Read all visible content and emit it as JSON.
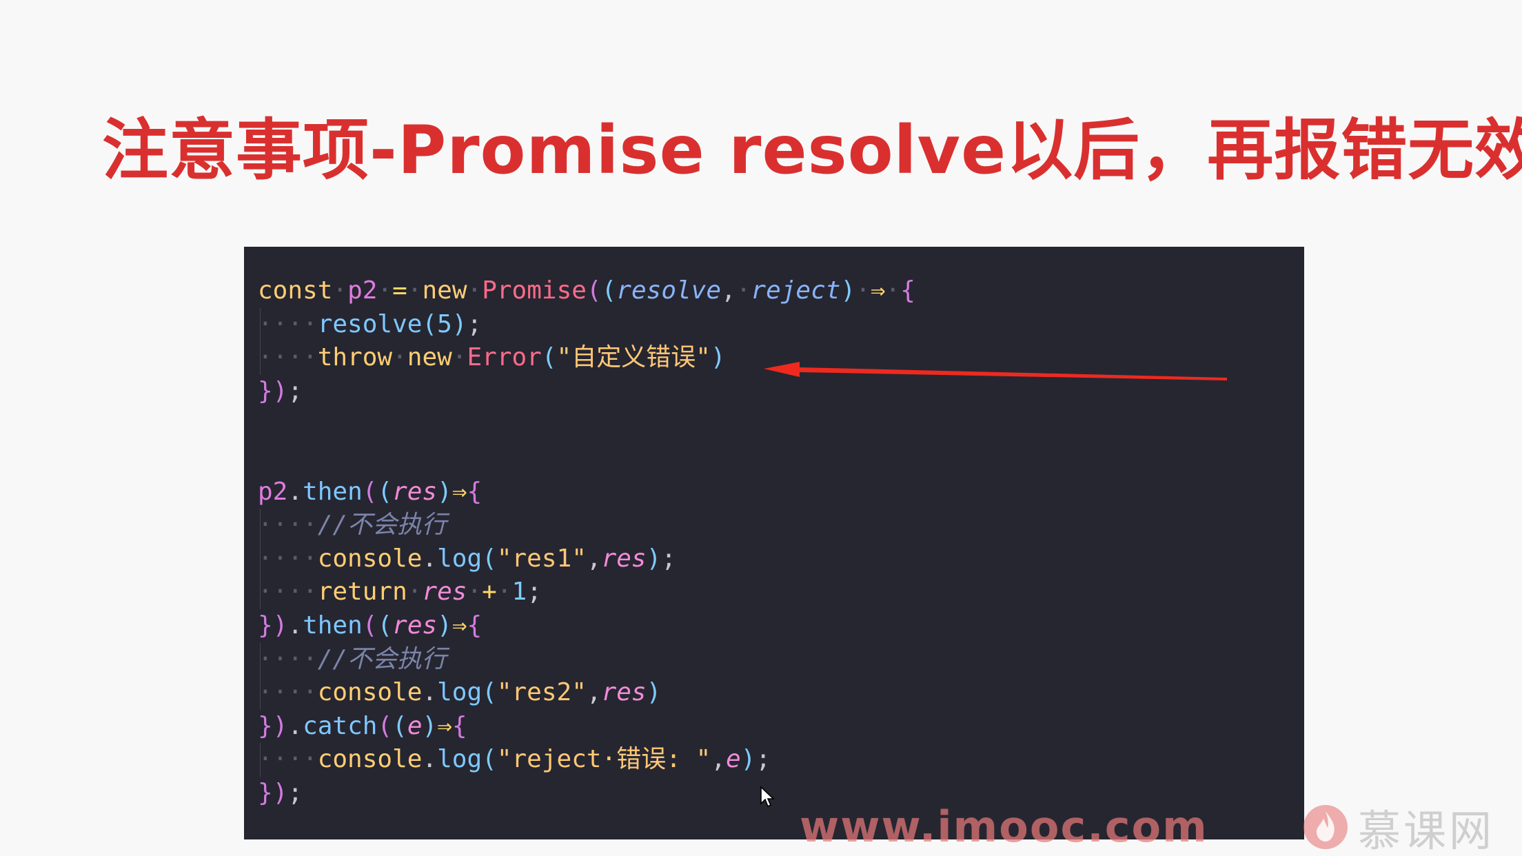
{
  "slide": {
    "title": "注意事项-Promise resolve以后，再报错无效"
  },
  "code": {
    "lines": [
      {
        "tokens": [
          [
            "kw",
            "const"
          ],
          [
            "dot",
            "·"
          ],
          [
            "var",
            "p2"
          ],
          [
            "dot",
            "·"
          ],
          [
            "op",
            "="
          ],
          [
            "dot",
            "·"
          ],
          [
            "kw",
            "new"
          ],
          [
            "dot",
            "·"
          ],
          [
            "cls",
            "Promise"
          ],
          [
            "brace",
            "("
          ],
          [
            "paren",
            "("
          ],
          [
            "param",
            "resolve"
          ],
          [
            "punc",
            ","
          ],
          [
            "dot",
            "·"
          ],
          [
            "param",
            "reject"
          ],
          [
            "paren",
            ")"
          ],
          [
            "dot",
            "·"
          ],
          [
            "op",
            "⇒"
          ],
          [
            "dot",
            "·"
          ],
          [
            "brace",
            "{"
          ]
        ]
      },
      {
        "indent": true,
        "tokens": [
          [
            "dot",
            "····"
          ],
          [
            "fn",
            "resolve"
          ],
          [
            "paren",
            "("
          ],
          [
            "num",
            "5"
          ],
          [
            "paren",
            ")"
          ],
          [
            "punc",
            ";"
          ]
        ]
      },
      {
        "indent": true,
        "tokens": [
          [
            "dot",
            "····"
          ],
          [
            "kw",
            "throw"
          ],
          [
            "dot",
            "·"
          ],
          [
            "kw",
            "new"
          ],
          [
            "dot",
            "·"
          ],
          [
            "cls",
            "Error"
          ],
          [
            "paren",
            "("
          ],
          [
            "str",
            "\"自定义错误\""
          ],
          [
            "paren",
            ")"
          ]
        ]
      },
      {
        "tokens": [
          [
            "brace",
            "}"
          ],
          [
            "brace",
            ")"
          ],
          [
            "punc",
            ";"
          ]
        ]
      },
      {
        "tokens": []
      },
      {
        "tokens": []
      },
      {
        "tokens": [
          [
            "var",
            "p2"
          ],
          [
            "punc",
            "."
          ],
          [
            "fn",
            "then"
          ],
          [
            "brace",
            "("
          ],
          [
            "paren",
            "("
          ],
          [
            "param2",
            "res"
          ],
          [
            "paren",
            ")"
          ],
          [
            "op",
            "⇒"
          ],
          [
            "brace",
            "{"
          ]
        ]
      },
      {
        "indent": true,
        "tokens": [
          [
            "dot",
            "····"
          ],
          [
            "comment",
            "//不会执行"
          ]
        ]
      },
      {
        "indent": true,
        "tokens": [
          [
            "dot",
            "····"
          ],
          [
            "kw",
            "console"
          ],
          [
            "punc",
            "."
          ],
          [
            "fn",
            "log"
          ],
          [
            "paren",
            "("
          ],
          [
            "str",
            "\"res1\""
          ],
          [
            "punc",
            ","
          ],
          [
            "param2",
            "res"
          ],
          [
            "paren",
            ")"
          ],
          [
            "punc",
            ";"
          ]
        ]
      },
      {
        "indent": true,
        "tokens": [
          [
            "dot",
            "····"
          ],
          [
            "kw",
            "return"
          ],
          [
            "dot",
            "·"
          ],
          [
            "param2",
            "res"
          ],
          [
            "dot",
            "·"
          ],
          [
            "op",
            "+"
          ],
          [
            "dot",
            "·"
          ],
          [
            "num",
            "1"
          ],
          [
            "punc",
            ";"
          ]
        ]
      },
      {
        "tokens": [
          [
            "brace",
            "}"
          ],
          [
            "brace",
            ")"
          ],
          [
            "punc",
            "."
          ],
          [
            "fn",
            "then"
          ],
          [
            "brace",
            "("
          ],
          [
            "paren",
            "("
          ],
          [
            "param2",
            "res"
          ],
          [
            "paren",
            ")"
          ],
          [
            "op",
            "⇒"
          ],
          [
            "brace",
            "{"
          ]
        ]
      },
      {
        "indent": true,
        "tokens": [
          [
            "dot",
            "····"
          ],
          [
            "comment",
            "//不会执行"
          ]
        ]
      },
      {
        "indent": true,
        "tokens": [
          [
            "dot",
            "····"
          ],
          [
            "kw",
            "console"
          ],
          [
            "punc",
            "."
          ],
          [
            "fn",
            "log"
          ],
          [
            "paren",
            "("
          ],
          [
            "str",
            "\"res2\""
          ],
          [
            "punc",
            ","
          ],
          [
            "param2",
            "res"
          ],
          [
            "paren",
            ")"
          ]
        ]
      },
      {
        "tokens": [
          [
            "brace",
            "}"
          ],
          [
            "brace",
            ")"
          ],
          [
            "punc",
            "."
          ],
          [
            "fn",
            "catch"
          ],
          [
            "brace",
            "("
          ],
          [
            "paren",
            "("
          ],
          [
            "param2",
            "e"
          ],
          [
            "paren",
            ")"
          ],
          [
            "op",
            "⇒"
          ],
          [
            "brace",
            "{"
          ]
        ]
      },
      {
        "indent": true,
        "tokens": [
          [
            "dot",
            "····"
          ],
          [
            "kw",
            "console"
          ],
          [
            "punc",
            "."
          ],
          [
            "fn",
            "log"
          ],
          [
            "paren",
            "("
          ],
          [
            "str",
            "\"reject·错误: \""
          ],
          [
            "punc",
            ","
          ],
          [
            "param2",
            "e"
          ],
          [
            "paren",
            ")"
          ],
          [
            "punc",
            ";"
          ]
        ]
      },
      {
        "tokens": [
          [
            "brace",
            "}"
          ],
          [
            "brace",
            ")"
          ],
          [
            "punc",
            ";"
          ]
        ]
      }
    ]
  },
  "watermark": {
    "url": "www.imooc.com",
    "brand": "慕课网"
  },
  "colors": {
    "title": "#d9302f",
    "panel_bg": "#262631",
    "arrow": "#ee2a1f"
  },
  "icons": {
    "annotation": "red-arrow-icon",
    "cursor": "mouse-pointer-icon",
    "logo": "imooc-flame-logo-icon"
  }
}
